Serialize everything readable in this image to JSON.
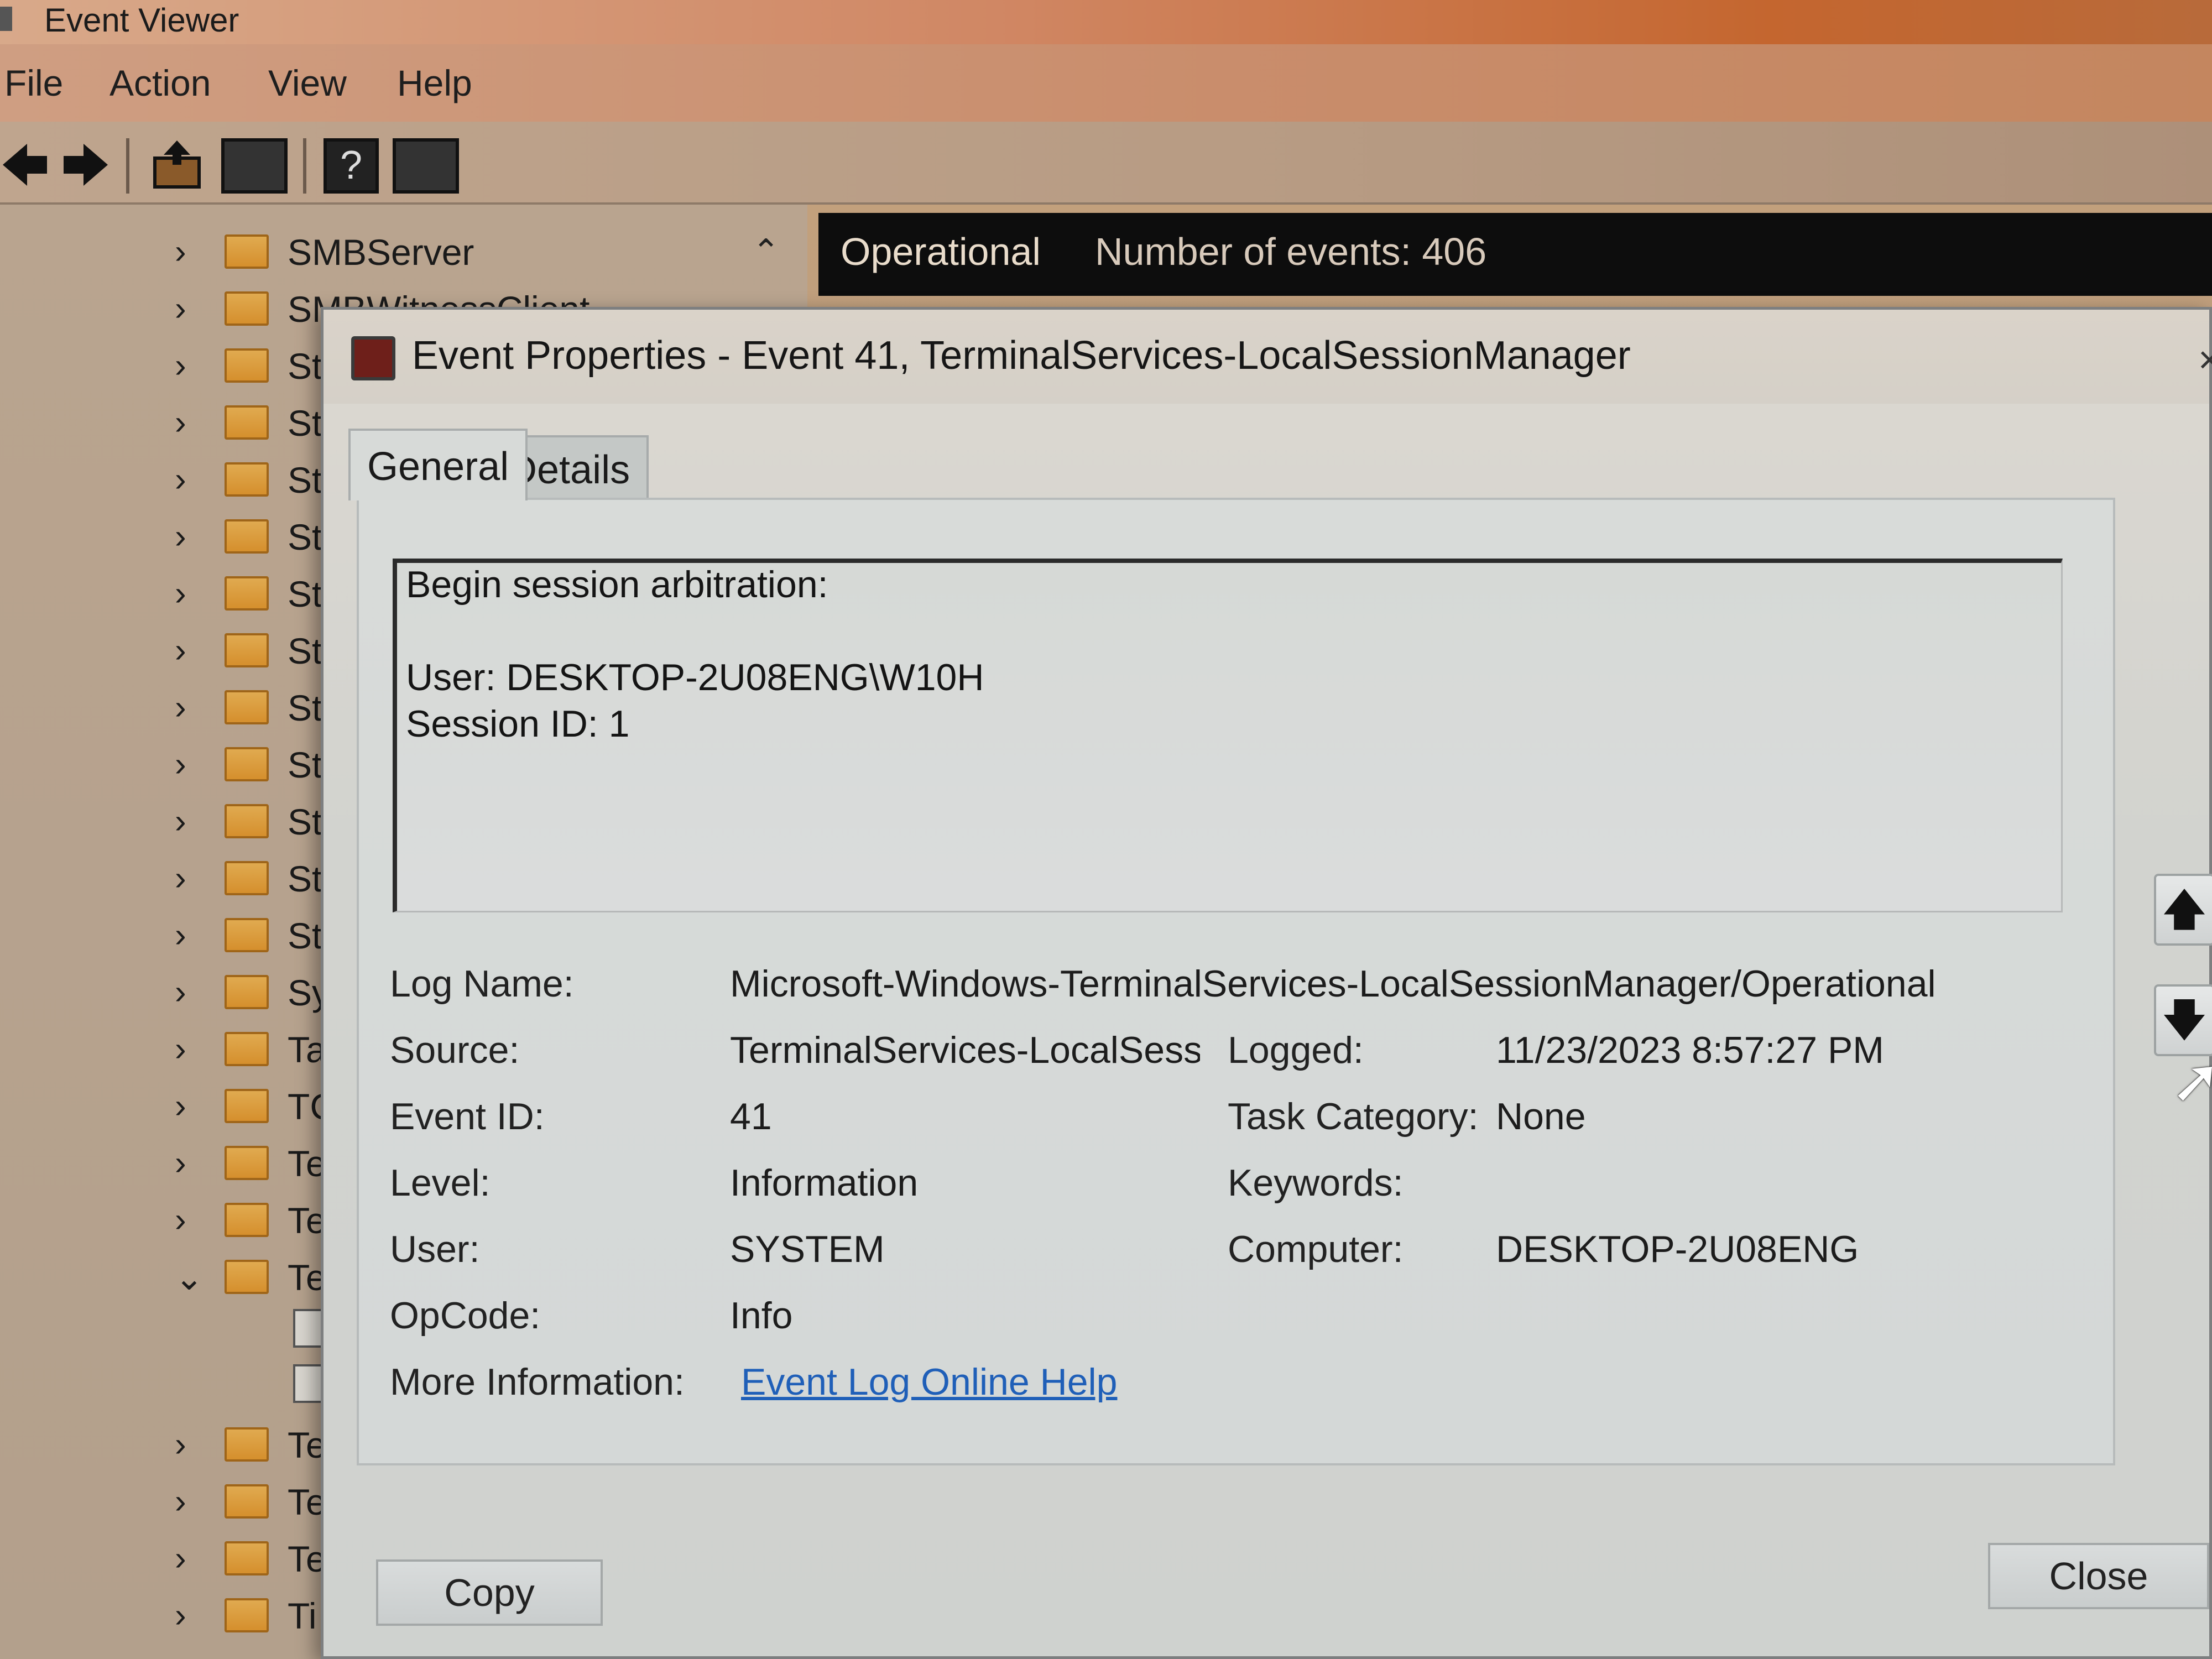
{
  "window": {
    "title": "Event Viewer"
  },
  "menu": [
    "File",
    "Action",
    "View",
    "Help"
  ],
  "toolbar": {
    "back_icon": "back-arrow-icon",
    "forward_icon": "forward-arrow-icon",
    "up_icon": "up-folder-icon",
    "show_hide_icon": "console-tree-icon",
    "help_icon": "help-icon",
    "action_pane_icon": "action-pane-icon",
    "help_glyph": "?"
  },
  "tree": {
    "items": [
      {
        "label": "SMBServer",
        "state": "collapsed"
      },
      {
        "label": "SMBWitnessClient",
        "state": "collapsed"
      },
      {
        "label": "St",
        "state": "collapsed"
      },
      {
        "label": "St",
        "state": "collapsed"
      },
      {
        "label": "St",
        "state": "collapsed"
      },
      {
        "label": "St",
        "state": "collapsed"
      },
      {
        "label": "St",
        "state": "collapsed"
      },
      {
        "label": "St",
        "state": "collapsed"
      },
      {
        "label": "St",
        "state": "collapsed"
      },
      {
        "label": "St",
        "state": "collapsed"
      },
      {
        "label": "St",
        "state": "collapsed"
      },
      {
        "label": "St",
        "state": "collapsed"
      },
      {
        "label": "St",
        "state": "collapsed"
      },
      {
        "label": "Sy",
        "state": "collapsed"
      },
      {
        "label": "Ta",
        "state": "collapsed"
      },
      {
        "label": "TC",
        "state": "collapsed"
      },
      {
        "label": "Te",
        "state": "collapsed"
      },
      {
        "label": "Te",
        "state": "collapsed"
      },
      {
        "label": "Te",
        "state": "expanded"
      },
      {
        "label": "Te",
        "state": "collapsed"
      },
      {
        "label": "Te",
        "state": "collapsed"
      },
      {
        "label": "Te",
        "state": "collapsed"
      },
      {
        "label": "Ti",
        "state": "collapsed"
      }
    ]
  },
  "log_header": {
    "name": "Operational",
    "count_text": "Number of events: 406"
  },
  "dialog": {
    "title": "Event Properties - Event 41, TerminalServices-LocalSessionManager",
    "close_glyph": "×",
    "tabs": [
      "General",
      "Details"
    ],
    "description_lines": [
      "Begin session arbitration:",
      "",
      "User: DESKTOP-2U08ENG\\W10H",
      "Session ID: 1"
    ],
    "labels": {
      "log_name": "Log Name:",
      "source": "Source:",
      "event_id": "Event ID:",
      "level": "Level:",
      "user": "User:",
      "opcode": "OpCode:",
      "more_info": "More Information:",
      "logged": "Logged:",
      "task_category": "Task Category:",
      "keywords": "Keywords:",
      "computer": "Computer:"
    },
    "values": {
      "log_name": "Microsoft-Windows-TerminalServices-LocalSessionManager/Operational",
      "source": "TerminalServices-LocalSessionManager",
      "event_id": "41",
      "level": "Information",
      "user": "SYSTEM",
      "opcode": "Info",
      "more_info_link": "Event Log Online Help",
      "logged": "11/23/2023 8:57:27 PM",
      "task_category": "None",
      "keywords": "",
      "computer": "DESKTOP-2U08ENG"
    },
    "buttons": {
      "copy": "Copy",
      "close": "Close",
      "up_glyph": "🡅",
      "down_glyph": "🡇"
    }
  }
}
